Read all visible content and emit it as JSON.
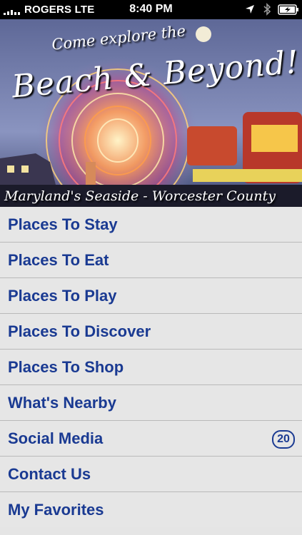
{
  "status_bar": {
    "carrier": "ROGERS  LTE",
    "time": "8:40 PM"
  },
  "banner": {
    "line1": "Come explore the",
    "line2": "Beach & Beyond!",
    "line3": "Maryland's Seaside - Worcester County",
    "colors": {
      "sky": "#7f89b7",
      "text": "#ffffff"
    }
  },
  "menu": {
    "items": [
      {
        "label": "Places To Stay"
      },
      {
        "label": "Places To Eat"
      },
      {
        "label": "Places To Play"
      },
      {
        "label": "Places To Discover"
      },
      {
        "label": "Places To Shop"
      },
      {
        "label": "What's Nearby"
      },
      {
        "label": "Social Media",
        "badge": "20"
      },
      {
        "label": "Contact Us"
      },
      {
        "label": "My Favorites"
      }
    ],
    "colors": {
      "text": "#1a3a92",
      "row": "#e6e6e6"
    }
  }
}
